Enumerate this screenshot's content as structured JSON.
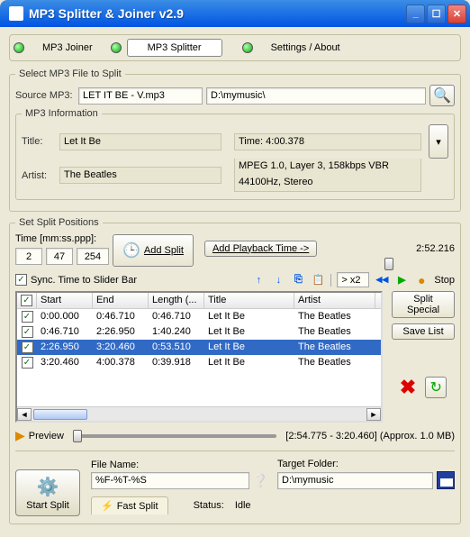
{
  "window": {
    "title": "MP3 Splitter & Joiner v2.9"
  },
  "tabs": {
    "joiner": "MP3 Joiner",
    "splitter": "MP3 Splitter",
    "settings": "Settings / About"
  },
  "select": {
    "legend": "Select MP3 File to Split",
    "source_lbl": "Source MP3:",
    "source_file": "LET IT BE - V.mp3",
    "source_path": "D:\\mymusic\\"
  },
  "info": {
    "legend": "MP3 Information",
    "title_lbl": "Title:",
    "title": "Let It Be",
    "artist_lbl": "Artist:",
    "artist": "The Beatles",
    "time": "Time: 4:00.378",
    "codec": "MPEG 1.0, Layer 3, 158kbps VBR",
    "freq": "44100Hz, Stereo"
  },
  "split": {
    "legend": "Set Split Positions",
    "time_lbl": "Time [mm:ss.ppp]:",
    "mm": "2",
    "ss": "47",
    "ppp": "254",
    "add_split": "Add Split",
    "add_playback": "Add Playback Time ->",
    "total": "2:52.216",
    "sync": "Sync. Time to Slider Bar",
    "speed": "> x2",
    "stop": "Stop"
  },
  "cols": {
    "start": "Start",
    "end": "End",
    "length": "Length (...",
    "title": "Title",
    "artist": "Artist"
  },
  "rows": [
    {
      "start": "0:00.000",
      "end": "0:46.710",
      "length": "0:46.710",
      "title": "Let It Be",
      "artist": "The Beatles",
      "sel": false
    },
    {
      "start": "0:46.710",
      "end": "2:26.950",
      "length": "1:40.240",
      "title": "Let It Be",
      "artist": "The Beatles",
      "sel": false
    },
    {
      "start": "2:26.950",
      "end": "3:20.460",
      "length": "0:53.510",
      "title": "Let It Be",
      "artist": "The Beatles",
      "sel": true
    },
    {
      "start": "3:20.460",
      "end": "4:00.378",
      "length": "0:39.918",
      "title": "Let It Be",
      "artist": "The Beatles",
      "sel": false
    }
  ],
  "side": {
    "split_special": "Split Special",
    "save_list": "Save List"
  },
  "preview": {
    "label": "Preview",
    "range": "[2:54.775 - 3:20.460] (Approx. 1.0 MB)"
  },
  "bottom": {
    "filename_lbl": "File Name:",
    "filename": "%F-%T-%S",
    "target_lbl": "Target Folder:",
    "target": "D:\\mymusic",
    "start_split": "Start Split",
    "fast_split": "Fast Split",
    "status_lbl": "Status:",
    "status": "Idle"
  }
}
